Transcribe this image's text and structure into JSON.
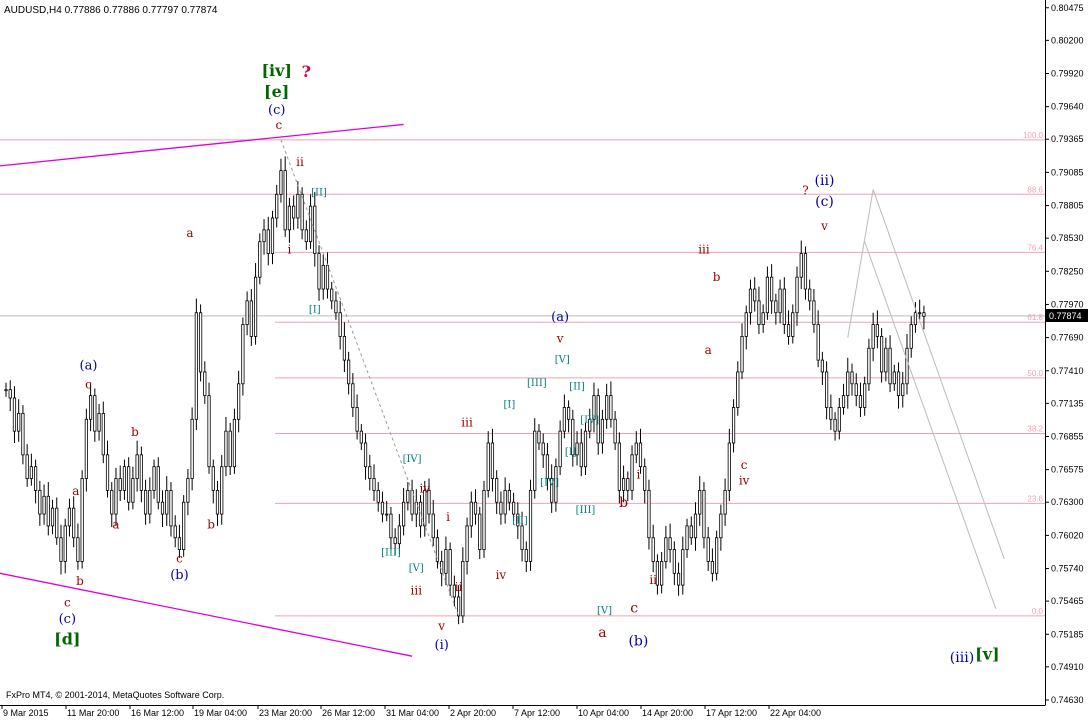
{
  "header": {
    "symbol_line": "AUDUSD,H4  0.77886 0.77886 0.77797 0.77874"
  },
  "footer": {
    "copyright": "FxPro MT4, © 2001-2014, MetaQuotes Software Corp."
  },
  "colors": {
    "candle": "#000000",
    "channel": "#dd00dd",
    "fib": "#f2a0b0",
    "wave_red": "#990000",
    "wave_blue": "#0000aa",
    "wave_green": "#006600",
    "wave_teal": "#008080",
    "marker": "#cc0044",
    "projection": "#bbbbbb",
    "price_tag_bg": "#000000"
  },
  "chart_data": {
    "type": "candlestick",
    "symbol": "AUDUSD",
    "timeframe": "H4",
    "ylim": [
      0.7463,
      0.8049
    ],
    "y_ticks": [
      0.80475,
      0.802,
      0.7992,
      0.7964,
      0.79365,
      0.79085,
      0.78805,
      0.7853,
      0.7825,
      0.7797,
      0.7769,
      0.7741,
      0.77135,
      0.76855,
      0.76575,
      0.763,
      0.7602,
      0.7574,
      0.75465,
      0.75185,
      0.7491,
      0.7463
    ],
    "x_labels": [
      "9 Mar 2015",
      "11 Mar 20:00",
      "16 Mar 12:00",
      "19 Mar 04:00",
      "23 Mar 20:00",
      "26 Mar 12:00",
      "31 Mar 04:00",
      "2 Apr 20:00",
      "7 Apr 12:00",
      "10 Apr 04:00",
      "14 Apr 20:00",
      "17 Apr 12:00",
      "22 Apr 04:00"
    ],
    "current_price": "0.77874",
    "fib_levels": [
      {
        "label": "100.0",
        "price": 0.7936
      },
      {
        "label": "88.6",
        "price": 0.789
      },
      {
        "label": "76.4",
        "price": 0.7841
      },
      {
        "label": "61.8",
        "price": 0.7782
      },
      {
        "label": "50.0",
        "price": 0.7735
      },
      {
        "label": "38.2",
        "price": 0.7688
      },
      {
        "label": "23.6",
        "price": 0.7629
      },
      {
        "label": "0.0",
        "price": 0.7534
      }
    ],
    "channel_lines": [
      {
        "t1": -1.5,
        "p1": 0.7914,
        "t2": 94,
        "p2": 0.7949
      },
      {
        "t1": -1.5,
        "p1": 0.757,
        "t2": 96,
        "p2": 0.75
      }
    ],
    "projection_lines": [
      {
        "t1": 199,
        "p1": 0.7769,
        "t2": 205,
        "p2": 0.7894
      },
      {
        "t1": 205,
        "p1": 0.7894,
        "t2": 236,
        "p2": 0.7582
      },
      {
        "t1": 203,
        "p1": 0.785,
        "t2": 234,
        "p2": 0.754
      }
    ],
    "wave_path_dashed": {
      "t1": 65,
      "p1": 0.7936,
      "t2": 107,
      "p2": 0.7534
    },
    "closes": [
      0.7725,
      0.7718,
      0.769,
      0.7705,
      0.767,
      0.765,
      0.766,
      0.764,
      0.762,
      0.7635,
      0.761,
      0.7625,
      0.76,
      0.758,
      0.761,
      0.7625,
      0.76,
      0.758,
      0.765,
      0.77,
      0.772,
      0.769,
      0.7705,
      0.767,
      0.764,
      0.762,
      0.765,
      0.764,
      0.766,
      0.763,
      0.765,
      0.767,
      0.764,
      0.762,
      0.764,
      0.766,
      0.763,
      0.762,
      0.764,
      0.761,
      0.76,
      0.759,
      0.763,
      0.765,
      0.77,
      0.779,
      0.774,
      0.772,
      0.766,
      0.764,
      0.762,
      0.766,
      0.769,
      0.766,
      0.77,
      0.773,
      0.778,
      0.78,
      0.777,
      0.782,
      0.785,
      0.786,
      0.784,
      0.787,
      0.789,
      0.791,
      0.786,
      0.788,
      0.787,
      0.789,
      0.786,
      0.785,
      0.788,
      0.784,
      0.781,
      0.783,
      0.781,
      0.78,
      0.779,
      0.777,
      0.775,
      0.773,
      0.771,
      0.769,
      0.768,
      0.766,
      0.765,
      0.764,
      0.763,
      0.762,
      0.762,
      0.76,
      0.7595,
      0.761,
      0.763,
      0.764,
      0.762,
      0.763,
      0.761,
      0.764,
      0.762,
      0.76,
      0.758,
      0.757,
      0.759,
      0.756,
      0.755,
      0.7534,
      0.758,
      0.761,
      0.763,
      0.762,
      0.759,
      0.764,
      0.768,
      0.765,
      0.763,
      0.762,
      0.764,
      0.763,
      0.762,
      0.761,
      0.759,
      0.758,
      0.764,
      0.769,
      0.768,
      0.767,
      0.765,
      0.763,
      0.766,
      0.769,
      0.771,
      0.77,
      0.767,
      0.768,
      0.766,
      0.769,
      0.77,
      0.772,
      0.768,
      0.77,
      0.772,
      0.77,
      0.768,
      0.764,
      0.765,
      0.764,
      0.767,
      0.768,
      0.766,
      0.764,
      0.76,
      0.758,
      0.756,
      0.758,
      0.76,
      0.759,
      0.757,
      0.756,
      0.759,
      0.761,
      0.76,
      0.762,
      0.764,
      0.76,
      0.758,
      0.757,
      0.76,
      0.762,
      0.764,
      0.768,
      0.771,
      0.774,
      0.777,
      0.779,
      0.781,
      0.78,
      0.778,
      0.779,
      0.782,
      0.78,
      0.779,
      0.781,
      0.778,
      0.777,
      0.779,
      0.782,
      0.784,
      0.781,
      0.78,
      0.778,
      0.775,
      0.774,
      0.771,
      0.77,
      0.769,
      0.771,
      0.772,
      0.774,
      0.773,
      0.772,
      0.771,
      0.773,
      0.776,
      0.778,
      0.777,
      0.774,
      0.776,
      0.773,
      0.774,
      0.772,
      0.773,
      0.776,
      0.778,
      0.779,
      0.779,
      0.7787
    ],
    "wave_labels": [
      {
        "text": "[iv]",
        "style": "green_bold",
        "t": 64,
        "p": 0.799,
        "size": 16
      },
      {
        "text": "?",
        "style": "marker",
        "t": 71,
        "p": 0.7989,
        "size": 16
      },
      {
        "text": "[e]",
        "style": "green_bold",
        "t": 64,
        "p": 0.7972,
        "size": 16
      },
      {
        "text": "(c)",
        "style": "blue",
        "t": 64,
        "p": 0.7958,
        "size": 13
      },
      {
        "text": "c",
        "style": "red",
        "t": 64.5,
        "p": 0.7945,
        "size": 12
      },
      {
        "text": "ii",
        "style": "red",
        "t": 69.5,
        "p": 0.7914,
        "size": 12
      },
      {
        "text": "[II]",
        "style": "teal",
        "t": 74,
        "p": 0.7889,
        "size": 10
      },
      {
        "text": "i",
        "style": "red",
        "t": 67,
        "p": 0.784,
        "size": 12
      },
      {
        "text": "[I]",
        "style": "teal",
        "t": 73,
        "p": 0.779,
        "size": 10
      },
      {
        "text": "a",
        "style": "red",
        "t": 43.5,
        "p": 0.7854,
        "size": 12
      },
      {
        "text": "(a)",
        "style": "blue",
        "t": 19.5,
        "p": 0.7742,
        "size": 13
      },
      {
        "text": "c",
        "style": "red",
        "t": 19.5,
        "p": 0.7726,
        "size": 12
      },
      {
        "text": "b",
        "style": "red",
        "t": 30.5,
        "p": 0.7686,
        "size": 12
      },
      {
        "text": "a",
        "style": "red",
        "t": 16.5,
        "p": 0.7636,
        "size": 12
      },
      {
        "text": "a",
        "style": "red",
        "t": 26,
        "p": 0.7608,
        "size": 12
      },
      {
        "text": "b",
        "style": "red",
        "t": 48.5,
        "p": 0.7608,
        "size": 12
      },
      {
        "text": "c",
        "style": "red",
        "t": 41,
        "p": 0.7579,
        "size": 12
      },
      {
        "text": "(b)",
        "style": "blue",
        "t": 41,
        "p": 0.7565,
        "size": 13
      },
      {
        "text": "b",
        "style": "red",
        "t": 17.5,
        "p": 0.756,
        "size": 12
      },
      {
        "text": "c",
        "style": "red",
        "t": 14.5,
        "p": 0.7542,
        "size": 12
      },
      {
        "text": "(c)",
        "style": "blue",
        "t": 14.5,
        "p": 0.7528,
        "size": 13
      },
      {
        "text": "[d]",
        "style": "green_bold",
        "t": 14.5,
        "p": 0.751,
        "size": 16
      },
      {
        "text": "[IV]",
        "style": "teal",
        "t": 96,
        "p": 0.7664,
        "size": 10
      },
      {
        "text": "iv",
        "style": "red",
        "t": 99,
        "p": 0.7638,
        "size": 12
      },
      {
        "text": "[III]",
        "style": "teal",
        "t": 91,
        "p": 0.7585,
        "size": 10
      },
      {
        "text": "[V]",
        "style": "teal",
        "t": 97,
        "p": 0.7572,
        "size": 10
      },
      {
        "text": "iii",
        "style": "red",
        "t": 97,
        "p": 0.7552,
        "size": 12
      },
      {
        "text": "v",
        "style": "red",
        "t": 103,
        "p": 0.7522,
        "size": 12
      },
      {
        "text": "(i)",
        "style": "blue",
        "t": 103,
        "p": 0.7506,
        "size": 13
      },
      {
        "text": "i",
        "style": "red",
        "t": 104.5,
        "p": 0.7614,
        "size": 12
      },
      {
        "text": "ii",
        "style": "red",
        "t": 107,
        "p": 0.7555,
        "size": 12
      },
      {
        "text": "iii",
        "style": "red",
        "t": 109,
        "p": 0.7694,
        "size": 12
      },
      {
        "text": "iv",
        "style": "red",
        "t": 117,
        "p": 0.7565,
        "size": 12
      },
      {
        "text": "[I]",
        "style": "teal",
        "t": 119,
        "p": 0.771,
        "size": 10
      },
      {
        "text": "[II]",
        "style": "teal",
        "t": 121.5,
        "p": 0.7612,
        "size": 10
      },
      {
        "text": "[III]",
        "style": "teal",
        "t": 125.5,
        "p": 0.7728,
        "size": 10
      },
      {
        "text": "[IV]",
        "style": "teal",
        "t": 128.5,
        "p": 0.7644,
        "size": 10
      },
      {
        "text": "[V]",
        "style": "teal",
        "t": 131.5,
        "p": 0.7748,
        "size": 10
      },
      {
        "text": "(a)",
        "style": "blue",
        "t": 131,
        "p": 0.7783,
        "size": 13
      },
      {
        "text": "v",
        "style": "red",
        "t": 131,
        "p": 0.7765,
        "size": 12
      },
      {
        "text": "[II]",
        "style": "teal",
        "t": 135,
        "p": 0.7725,
        "size": 10
      },
      {
        "text": "[IV]",
        "style": "teal",
        "t": 138,
        "p": 0.7697,
        "size": 10
      },
      {
        "text": "[I]",
        "style": "teal",
        "t": 133.5,
        "p": 0.767,
        "size": 10
      },
      {
        "text": "[III]",
        "style": "teal",
        "t": 137,
        "p": 0.7621,
        "size": 10
      },
      {
        "text": "[V]",
        "style": "teal",
        "t": 141.5,
        "p": 0.7536,
        "size": 10
      },
      {
        "text": "a",
        "style": "red",
        "t": 141,
        "p": 0.7516,
        "size": 14
      },
      {
        "text": "b",
        "style": "red",
        "t": 146,
        "p": 0.7626,
        "size": 14
      },
      {
        "text": "c",
        "style": "red",
        "t": 148.5,
        "p": 0.7537,
        "size": 14
      },
      {
        "text": "(b)",
        "style": "blue",
        "t": 149.5,
        "p": 0.7509,
        "size": 14
      },
      {
        "text": "i",
        "style": "red",
        "t": 149.5,
        "p": 0.765,
        "size": 12
      },
      {
        "text": "ii",
        "style": "red",
        "t": 153,
        "p": 0.7561,
        "size": 12
      },
      {
        "text": "iii",
        "style": "red",
        "t": 165,
        "p": 0.784,
        "size": 12
      },
      {
        "text": "b",
        "style": "red",
        "t": 168,
        "p": 0.7817,
        "size": 12
      },
      {
        "text": "a",
        "style": "red",
        "t": 166,
        "p": 0.7755,
        "size": 12
      },
      {
        "text": "c",
        "style": "red",
        "t": 174.5,
        "p": 0.7658,
        "size": 12
      },
      {
        "text": "iv",
        "style": "red",
        "t": 174.5,
        "p": 0.7645,
        "size": 12
      },
      {
        "text": "?",
        "style": "red_q",
        "t": 189,
        "p": 0.789,
        "size": 12
      },
      {
        "text": "(ii)",
        "style": "blue",
        "t": 193.5,
        "p": 0.7898,
        "size": 14
      },
      {
        "text": "(c)",
        "style": "blue",
        "t": 193.5,
        "p": 0.788,
        "size": 14
      },
      {
        "text": "v",
        "style": "red",
        "t": 193.5,
        "p": 0.786,
        "size": 12
      },
      {
        "text": "(iii)",
        "style": "blue",
        "t": 226,
        "p": 0.7495,
        "size": 14
      },
      {
        "text": "[v]",
        "style": "green_bold",
        "t": 232,
        "p": 0.7497,
        "size": 16
      }
    ]
  }
}
